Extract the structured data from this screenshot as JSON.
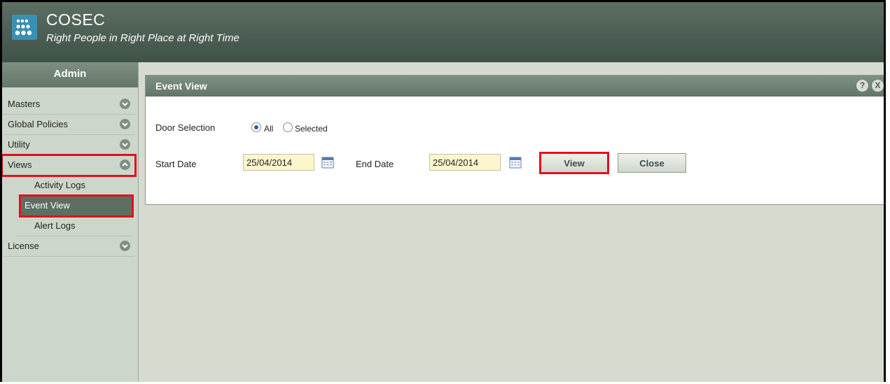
{
  "header": {
    "brand": "COSEC",
    "tagline": "Right People in Right Place at Right Time"
  },
  "sidebar": {
    "title": "Admin",
    "items": [
      {
        "label": "Masters"
      },
      {
        "label": "Global Policies"
      },
      {
        "label": "Utility"
      },
      {
        "label": "Views"
      },
      {
        "label": "License"
      }
    ],
    "views_sub": [
      {
        "label": "Activity Logs"
      },
      {
        "label": "Event View"
      },
      {
        "label": "Alert Logs"
      }
    ]
  },
  "panel": {
    "title": "Event View",
    "help": "?",
    "close": "X",
    "door_selection_label": "Door Selection",
    "door_options": [
      "All",
      "Selected"
    ],
    "door_selected": "All",
    "start_date_label": "Start Date",
    "start_date": "25/04/2014",
    "end_date_label": "End Date",
    "end_date": "25/04/2014",
    "view_button": "View",
    "close_button": "Close"
  },
  "colors": {
    "highlight": "#e0121c",
    "header": "#4b5d52",
    "input_bg": "#fdf6cd"
  },
  "icons": {
    "logo": "dots-logo-icon",
    "expand": "chevron-down-icon",
    "collapse": "chevron-up-icon",
    "calendar": "calendar-icon"
  }
}
